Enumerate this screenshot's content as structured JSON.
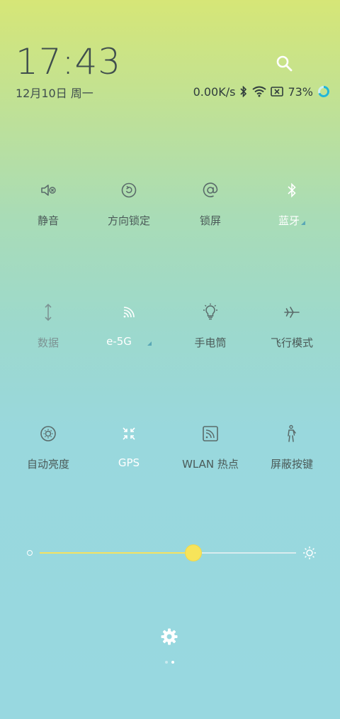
{
  "header": {
    "time": "17:43",
    "date": "12月10日 周一"
  },
  "status": {
    "net_speed": "0.00K/s",
    "battery": "73%"
  },
  "tiles": [
    {
      "label": "静音",
      "icon": "mute-icon"
    },
    {
      "label": "方向锁定",
      "icon": "rotation-lock-icon"
    },
    {
      "label": "锁屏",
      "icon": "lock-screen-icon"
    },
    {
      "label": "蓝牙",
      "icon": "bluetooth-icon"
    },
    {
      "label": "数据",
      "icon": "mobile-data-icon"
    },
    {
      "label": "e-5G",
      "icon": "wifi-signal-icon"
    },
    {
      "label": "手电筒",
      "icon": "flashlight-icon"
    },
    {
      "label": "飞行模式",
      "icon": "airplane-icon"
    },
    {
      "label": "自动亮度",
      "icon": "auto-brightness-icon"
    },
    {
      "label": "GPS",
      "icon": "gps-icon"
    },
    {
      "label": "WLAN 热点",
      "icon": "hotspot-icon"
    },
    {
      "label": "屏蔽按键",
      "icon": "block-keys-icon"
    }
  ],
  "brightness": {
    "level": 0.6
  },
  "pager": {
    "pages": 2,
    "current": 2
  }
}
